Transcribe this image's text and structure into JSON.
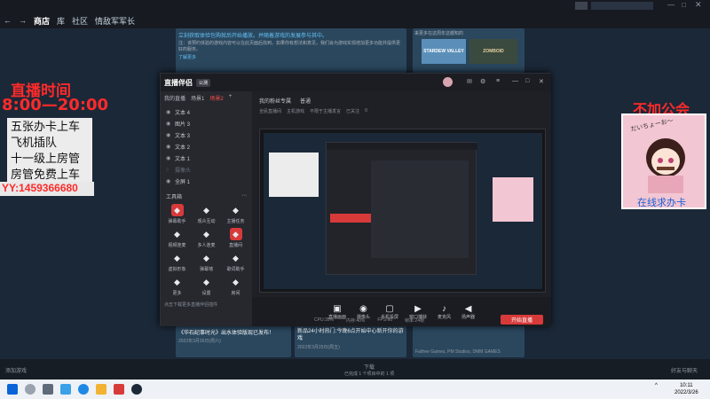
{
  "steam": {
    "nav_back": "←",
    "nav_forward": "→",
    "nav_tabs": [
      "商店",
      "库",
      "社区",
      "情敌军军长"
    ],
    "notice_line1": "立刻获取体验包购就后开始播放。并随着游戏的发展参与其中。",
    "notice_line2": "注：该预约体验的游戏内容可以在此页面后找到。如果你有想法和意见，我们会为游戏实现增加更多功能并提供更好的服务。",
    "notice_link": "了解更多",
    "promo_games": [
      "STARDEW VALLEY",
      "ZOMBOID"
    ],
    "promo_title": "来更多在这周年这都知的",
    "news": [
      {
        "title": "《华石纪事时光》出水体验版现已发布！",
        "date": "2022年3月26日(周六)"
      },
      {
        "title": "新品24小时热门:今晚6点开始中心新开你的游戏",
        "date": "2022年3月25日(周五)"
      }
    ],
    "publisher_line": "Fatfree Games, PM Studios, DMM GAMES",
    "footer_left": "添加游戏",
    "footer_center": "下载",
    "footer_center_sub": "已完成 1 个项目中的 1 项",
    "footer_right": "好友与聊天"
  },
  "overlay_left": {
    "title": "直播时间",
    "hours": "8:00—20:00",
    "lines": [
      "五张办卡上车",
      "飞机插队",
      "十一级上房管",
      "房管免费上车"
    ],
    "yy": "YY:1459366680"
  },
  "overlay_right": {
    "title": "不加公会",
    "caption": "在线求办卡",
    "sticker_text": "だいちょーお〜"
  },
  "app": {
    "brand": "直播伴侣",
    "version_badge": "公测",
    "user_name": "我的直播间",
    "sidebar_tabs": [
      "我的直播",
      "场景1",
      "场景2"
    ],
    "scene_items": [
      "文本 4",
      "图片 3",
      "文本 3",
      "文本 2",
      "文本 1",
      "摄像头",
      "全屏 1"
    ],
    "tools_title": "工具箱",
    "tools": [
      {
        "label": "弹幕助手",
        "icon": "chat-icon",
        "red": true
      },
      {
        "label": "观众互动",
        "icon": "user-icon",
        "red": false
      },
      {
        "label": "主播任务",
        "icon": "task-icon",
        "red": false
      },
      {
        "label": "视频连麦",
        "icon": "video-icon",
        "red": false
      },
      {
        "label": "多人连麦",
        "icon": "upload-icon",
        "red": false
      },
      {
        "label": "直播间",
        "icon": "live-icon",
        "red": true
      },
      {
        "label": "虚拟形象",
        "icon": "avatar-icon",
        "red": false
      },
      {
        "label": "弹幕墙",
        "icon": "wall-icon",
        "red": false
      },
      {
        "label": "歌词助手",
        "icon": "lyrics-icon",
        "red": false
      },
      {
        "label": "更多",
        "icon": "more-icon",
        "red": false
      },
      {
        "label": "设置",
        "icon": "settings-icon",
        "red": false
      },
      {
        "label": "房间",
        "icon": "room-icon",
        "red": false
      }
    ],
    "sidebar_footer": "点击下载更多直播伴侣插件",
    "main_tabs": [
      "我的粉丝专属",
      "普通"
    ],
    "stream_tags": [
      "全民直播间",
      "主机游戏",
      "不限于主播发言",
      "已关注",
      "0"
    ],
    "bottom_buttons": [
      {
        "label": "直播画面",
        "icon": "screen-icon"
      },
      {
        "label": "摄像头",
        "icon": "camera-icon"
      },
      {
        "label": "手机投屏",
        "icon": "phone-icon"
      },
      {
        "label": "窗口捕获",
        "icon": "window-icon"
      },
      {
        "label": "麦克风",
        "icon": "mic-icon"
      },
      {
        "label": "扬声器",
        "icon": "speaker-icon"
      }
    ],
    "status_items": [
      "CPU:35%",
      "内存:40%",
      "FPS:60",
      "帧率:24帧"
    ],
    "start_button": "开始直播"
  },
  "taskbar": {
    "time": "10:11",
    "date": "2022/3/26"
  }
}
